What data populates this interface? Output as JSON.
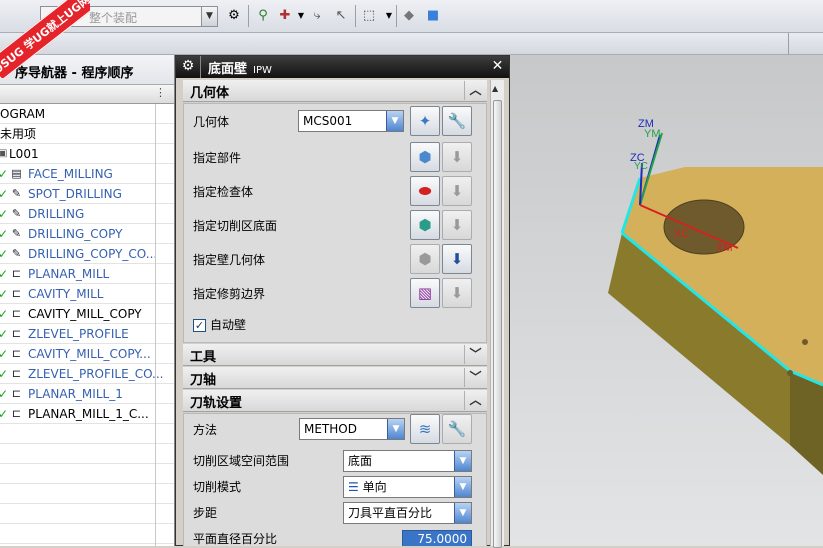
{
  "logo": {
    "text": "9SUG",
    "subtitle": "学UG就上UG网"
  },
  "toolbar": {
    "assembly_combo": "整个装配"
  },
  "navigator": {
    "title": "序导航器 - 程序顺序",
    "rows": [
      {
        "label": "OGRAM",
        "kind": "plain"
      },
      {
        "label": "未用项",
        "kind": "plain"
      },
      {
        "label": "L001",
        "kind": "group"
      },
      {
        "label": "FACE_MILLING",
        "kind": "op",
        "dark": false,
        "icon": "face-mill-icon"
      },
      {
        "label": "SPOT_DRILLING",
        "kind": "op",
        "dark": false,
        "icon": "drill-op-icon"
      },
      {
        "label": "DRILLING",
        "kind": "op",
        "dark": false,
        "icon": "drill-op-icon"
      },
      {
        "label": "DRILLING_COPY",
        "kind": "op",
        "dark": false,
        "icon": "drill-op-icon"
      },
      {
        "label": "DRILLING_COPY_CO...",
        "kind": "op",
        "dark": false,
        "icon": "drill-op-icon"
      },
      {
        "label": "PLANAR_MILL",
        "kind": "op",
        "dark": false,
        "icon": "planar-mill-icon"
      },
      {
        "label": "CAVITY_MILL",
        "kind": "op",
        "dark": false,
        "icon": "cavity-mill-icon"
      },
      {
        "label": "CAVITY_MILL_COPY",
        "kind": "op",
        "dark": true,
        "icon": "cavity-mill-icon"
      },
      {
        "label": "ZLEVEL_PROFILE",
        "kind": "op",
        "dark": false,
        "icon": "zlevel-icon"
      },
      {
        "label": "CAVITY_MILL_COPY...",
        "kind": "op",
        "dark": false,
        "icon": "cavity-mill-icon"
      },
      {
        "label": "ZLEVEL_PROFILE_CO...",
        "kind": "op",
        "dark": false,
        "icon": "zlevel-icon"
      },
      {
        "label": "PLANAR_MILL_1",
        "kind": "op",
        "dark": false,
        "icon": "planar-mill-icon"
      },
      {
        "label": "PLANAR_MILL_1_C...",
        "kind": "op",
        "dark": true,
        "icon": "planar-mill-icon"
      }
    ]
  },
  "dialog": {
    "title": "底面壁",
    "title_suffix": "IPW",
    "geometry": {
      "header": "几何体",
      "geometry_label": "几何体",
      "geometry_value": "MCS001",
      "specify_part": "指定部件",
      "specify_check": "指定检查体",
      "specify_floor": "指定切削区底面",
      "specify_wall": "指定壁几何体",
      "specify_trim": "指定修剪边界",
      "auto_wall": "自动壁",
      "auto_wall_checked": true
    },
    "tool": {
      "header": "工具"
    },
    "axis": {
      "header": "刀轴"
    },
    "path": {
      "header": "刀轨设置",
      "method_label": "方法",
      "method_value": "METHOD",
      "cut_region_label": "切削区域空间范围",
      "cut_region_value": "底面",
      "cut_pattern_label": "切削模式",
      "cut_pattern_value": "单向",
      "stepover_label": "步距",
      "stepover_value": "刀具平直百分比",
      "flat_pct_label": "平面直径百分比",
      "flat_pct_value": "75.0000"
    }
  },
  "viewport": {
    "axes": {
      "zm": "ZM",
      "ym": "YM",
      "zc": "ZC",
      "yc": "YC",
      "xc": "XC",
      "xm": "XM"
    },
    "colors": {
      "part_top": "#d4b05a",
      "part_side": "#8a7a2c",
      "edge_highlight": "#22e6e6",
      "hole": "#6e5a2c"
    }
  }
}
